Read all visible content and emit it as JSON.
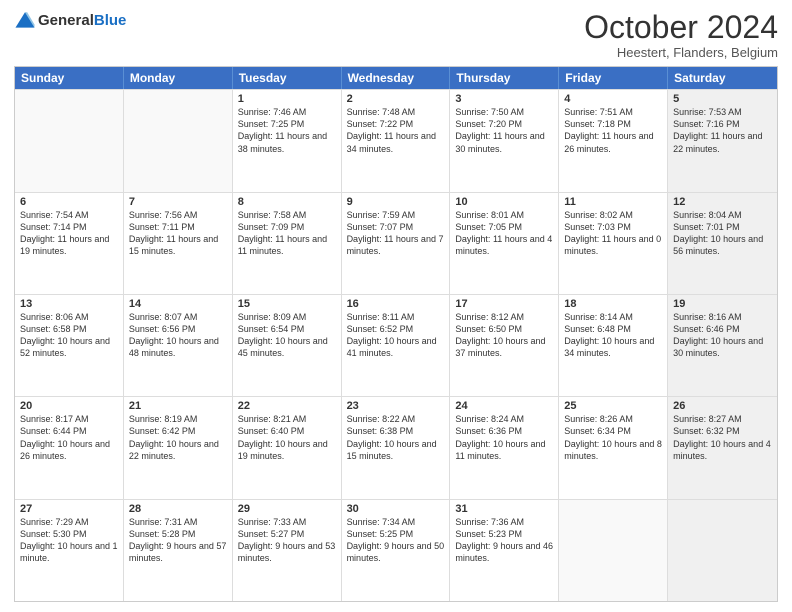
{
  "header": {
    "logo_line1": "General",
    "logo_line2": "Blue",
    "month": "October 2024",
    "location": "Heestert, Flanders, Belgium"
  },
  "days_of_week": [
    "Sunday",
    "Monday",
    "Tuesday",
    "Wednesday",
    "Thursday",
    "Friday",
    "Saturday"
  ],
  "weeks": [
    [
      {
        "day": "",
        "content": "",
        "empty": true
      },
      {
        "day": "",
        "content": "",
        "empty": true
      },
      {
        "day": "1",
        "content": "Sunrise: 7:46 AM\nSunset: 7:25 PM\nDaylight: 11 hours and 38 minutes.",
        "empty": false
      },
      {
        "day": "2",
        "content": "Sunrise: 7:48 AM\nSunset: 7:22 PM\nDaylight: 11 hours and 34 minutes.",
        "empty": false
      },
      {
        "day": "3",
        "content": "Sunrise: 7:50 AM\nSunset: 7:20 PM\nDaylight: 11 hours and 30 minutes.",
        "empty": false
      },
      {
        "day": "4",
        "content": "Sunrise: 7:51 AM\nSunset: 7:18 PM\nDaylight: 11 hours and 26 minutes.",
        "empty": false
      },
      {
        "day": "5",
        "content": "Sunrise: 7:53 AM\nSunset: 7:16 PM\nDaylight: 11 hours and 22 minutes.",
        "empty": false,
        "shaded": true
      }
    ],
    [
      {
        "day": "6",
        "content": "Sunrise: 7:54 AM\nSunset: 7:14 PM\nDaylight: 11 hours and 19 minutes.",
        "empty": false
      },
      {
        "day": "7",
        "content": "Sunrise: 7:56 AM\nSunset: 7:11 PM\nDaylight: 11 hours and 15 minutes.",
        "empty": false
      },
      {
        "day": "8",
        "content": "Sunrise: 7:58 AM\nSunset: 7:09 PM\nDaylight: 11 hours and 11 minutes.",
        "empty": false
      },
      {
        "day": "9",
        "content": "Sunrise: 7:59 AM\nSunset: 7:07 PM\nDaylight: 11 hours and 7 minutes.",
        "empty": false
      },
      {
        "day": "10",
        "content": "Sunrise: 8:01 AM\nSunset: 7:05 PM\nDaylight: 11 hours and 4 minutes.",
        "empty": false
      },
      {
        "day": "11",
        "content": "Sunrise: 8:02 AM\nSunset: 7:03 PM\nDaylight: 11 hours and 0 minutes.",
        "empty": false
      },
      {
        "day": "12",
        "content": "Sunrise: 8:04 AM\nSunset: 7:01 PM\nDaylight: 10 hours and 56 minutes.",
        "empty": false,
        "shaded": true
      }
    ],
    [
      {
        "day": "13",
        "content": "Sunrise: 8:06 AM\nSunset: 6:58 PM\nDaylight: 10 hours and 52 minutes.",
        "empty": false
      },
      {
        "day": "14",
        "content": "Sunrise: 8:07 AM\nSunset: 6:56 PM\nDaylight: 10 hours and 48 minutes.",
        "empty": false
      },
      {
        "day": "15",
        "content": "Sunrise: 8:09 AM\nSunset: 6:54 PM\nDaylight: 10 hours and 45 minutes.",
        "empty": false
      },
      {
        "day": "16",
        "content": "Sunrise: 8:11 AM\nSunset: 6:52 PM\nDaylight: 10 hours and 41 minutes.",
        "empty": false
      },
      {
        "day": "17",
        "content": "Sunrise: 8:12 AM\nSunset: 6:50 PM\nDaylight: 10 hours and 37 minutes.",
        "empty": false
      },
      {
        "day": "18",
        "content": "Sunrise: 8:14 AM\nSunset: 6:48 PM\nDaylight: 10 hours and 34 minutes.",
        "empty": false
      },
      {
        "day": "19",
        "content": "Sunrise: 8:16 AM\nSunset: 6:46 PM\nDaylight: 10 hours and 30 minutes.",
        "empty": false,
        "shaded": true
      }
    ],
    [
      {
        "day": "20",
        "content": "Sunrise: 8:17 AM\nSunset: 6:44 PM\nDaylight: 10 hours and 26 minutes.",
        "empty": false
      },
      {
        "day": "21",
        "content": "Sunrise: 8:19 AM\nSunset: 6:42 PM\nDaylight: 10 hours and 22 minutes.",
        "empty": false
      },
      {
        "day": "22",
        "content": "Sunrise: 8:21 AM\nSunset: 6:40 PM\nDaylight: 10 hours and 19 minutes.",
        "empty": false
      },
      {
        "day": "23",
        "content": "Sunrise: 8:22 AM\nSunset: 6:38 PM\nDaylight: 10 hours and 15 minutes.",
        "empty": false
      },
      {
        "day": "24",
        "content": "Sunrise: 8:24 AM\nSunset: 6:36 PM\nDaylight: 10 hours and 11 minutes.",
        "empty": false
      },
      {
        "day": "25",
        "content": "Sunrise: 8:26 AM\nSunset: 6:34 PM\nDaylight: 10 hours and 8 minutes.",
        "empty": false
      },
      {
        "day": "26",
        "content": "Sunrise: 8:27 AM\nSunset: 6:32 PM\nDaylight: 10 hours and 4 minutes.",
        "empty": false,
        "shaded": true
      }
    ],
    [
      {
        "day": "27",
        "content": "Sunrise: 7:29 AM\nSunset: 5:30 PM\nDaylight: 10 hours and 1 minute.",
        "empty": false
      },
      {
        "day": "28",
        "content": "Sunrise: 7:31 AM\nSunset: 5:28 PM\nDaylight: 9 hours and 57 minutes.",
        "empty": false
      },
      {
        "day": "29",
        "content": "Sunrise: 7:33 AM\nSunset: 5:27 PM\nDaylight: 9 hours and 53 minutes.",
        "empty": false
      },
      {
        "day": "30",
        "content": "Sunrise: 7:34 AM\nSunset: 5:25 PM\nDaylight: 9 hours and 50 minutes.",
        "empty": false
      },
      {
        "day": "31",
        "content": "Sunrise: 7:36 AM\nSunset: 5:23 PM\nDaylight: 9 hours and 46 minutes.",
        "empty": false
      },
      {
        "day": "",
        "content": "",
        "empty": true
      },
      {
        "day": "",
        "content": "",
        "empty": true,
        "shaded": true
      }
    ]
  ]
}
